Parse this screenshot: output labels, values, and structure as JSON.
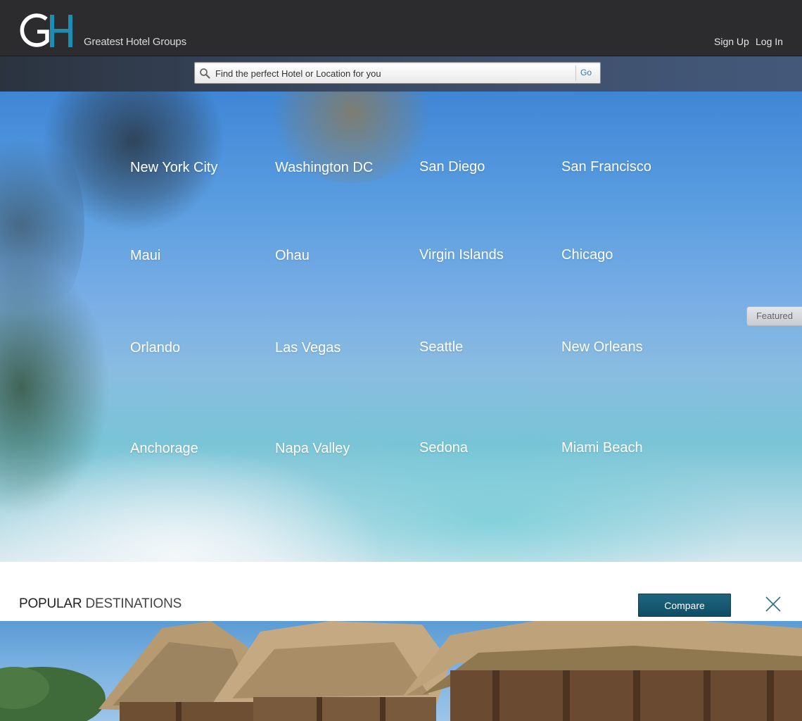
{
  "header": {
    "brand_name": "Greatest Hotel Groups",
    "logo_letters": "GH",
    "sign_up": "Sign Up",
    "log_in": "Log In"
  },
  "search": {
    "placeholder": "Find the perfect Hotel or Location for you",
    "go_label": "Go"
  },
  "destinations": [
    "New York City",
    "Washington DC",
    "San Diego",
    "San Francisco",
    "Maui",
    "Ohau",
    "Virgin Islands",
    "Chicago",
    "Orlando",
    "Las Vegas",
    "Seattle",
    "New Orleans",
    "Anchorage",
    "Napa Valley",
    "Sedona",
    "Miami Beach"
  ],
  "featured_tab": "Featured",
  "popular": {
    "title_bold": "POPULAR",
    "title_light": "DESTINATIONS",
    "compare_label": "Compare"
  },
  "colors": {
    "header_bg": "#2c2c2e",
    "accent_blue": "#1b8fb3",
    "compare_button": "#155a74"
  }
}
